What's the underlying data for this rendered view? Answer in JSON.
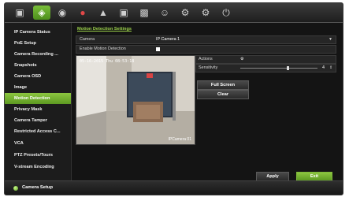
{
  "toolbar": {
    "icons": [
      "monitor-icon",
      "camera-config-icon",
      "network-icon",
      "record-icon",
      "alarm-icon",
      "storage-icon",
      "device-icon",
      "user-icon",
      "system-icon",
      "maintenance-icon",
      "shutdown-icon"
    ],
    "active_index": 1
  },
  "sidebar": {
    "items": [
      {
        "label": "IP Camera Status"
      },
      {
        "label": "PoE Setup"
      },
      {
        "label": "Camera Recording ..."
      },
      {
        "label": "Snapshots"
      },
      {
        "label": "Camera OSD"
      },
      {
        "label": "Image"
      },
      {
        "label": "Motion Detection"
      },
      {
        "label": "Privacy Mask"
      },
      {
        "label": "Camera Tamper"
      },
      {
        "label": "Restricted Access C..."
      },
      {
        "label": "VCA"
      },
      {
        "label": "PTZ Presets/Tours"
      },
      {
        "label": "V-stream Encoding"
      }
    ],
    "active_index": 6
  },
  "main": {
    "section_title": "Motion Detection Settings",
    "camera_label": "Camera",
    "camera_value": "IP Camera 1",
    "enable_label": "Enable Motion Detection",
    "enable_checked": true,
    "actions_label": "Actions",
    "sensitivity_label": "Sensitivity",
    "sensitivity_value": "4",
    "full_screen_label": "Full Screen",
    "clear_label": "Clear",
    "apply_label": "Apply",
    "exit_label": "Exit"
  },
  "preview": {
    "timestamp": "05-16-2015 Thu 08:53:18",
    "camera_name": "IPCamera 01"
  },
  "status": {
    "label": "Camera Setup"
  },
  "colors": {
    "accent_green": "#8cc63f",
    "background": "#141414",
    "record_red": "#e04848"
  }
}
